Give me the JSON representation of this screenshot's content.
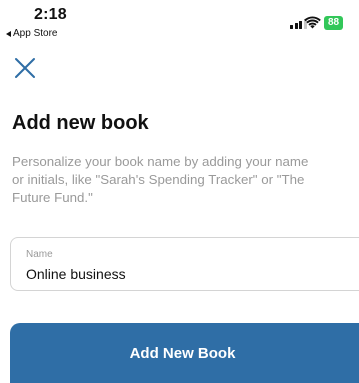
{
  "status_bar": {
    "time": "2:18",
    "back_app": "App Store",
    "battery": "88"
  },
  "icons": {
    "close": "close-icon",
    "back": "back-triangle-icon",
    "signal": "cellular-signal-icon",
    "wifi": "wifi-icon",
    "battery": "battery-icon"
  },
  "colors": {
    "primary_button": "#2f6ea6",
    "close_icon": "#2f6ea6",
    "battery": "#32c759",
    "subtitle": "#9a9a9a"
  },
  "page": {
    "title": "Add new book",
    "subtitle": "Personalize your book name by adding your name\nor initials, like \"Sarah's Spending Tracker\" or \"The\nFuture Fund.\""
  },
  "form": {
    "name_label": "Name",
    "name_value": "Online business"
  },
  "actions": {
    "add_label": "Add New Book"
  }
}
